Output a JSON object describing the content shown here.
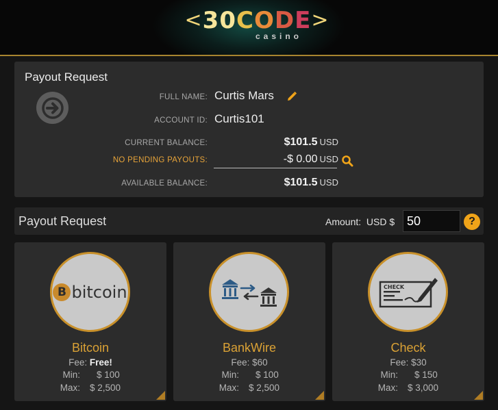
{
  "logo": {
    "bracket_left": "<",
    "digits": "30",
    "word_letters": [
      "C",
      "O",
      "D",
      "E"
    ],
    "bracket_right": ">",
    "sub": "casino"
  },
  "summary": {
    "title": "Payout Request",
    "full_name_label": "FULL NAME:",
    "full_name_value": "Curtis Mars",
    "account_id_label": "ACCOUNT ID:",
    "account_id_value": "Curtis101",
    "current_balance_label": "CURRENT BALANCE:",
    "current_balance_value": "$101.5",
    "pending_label": "NO PENDING PAYOUTS:",
    "pending_value": "-$ 0.00",
    "available_balance_label": "AVAILABLE BALANCE:",
    "available_balance_value": "$101.5",
    "currency_unit": "USD"
  },
  "request": {
    "title": "Payout Request",
    "amount_label": "Amount:",
    "currency_prefix": "USD $",
    "amount_value": "50",
    "help_label": "?"
  },
  "methods": [
    {
      "name": "Bitcoin",
      "logo_text": "bitcoin",
      "logo_symbol": "B",
      "fee_label": "Fee:",
      "fee_value": "Free!",
      "min_label": "Min:",
      "min_value": "$ 100",
      "max_label": "Max:",
      "max_value": "$ 2,500"
    },
    {
      "name": "BankWire",
      "fee_label": "Fee:",
      "fee_value": "$60",
      "min_label": "Min:",
      "min_value": "$ 100",
      "max_label": "Max:",
      "max_value": "$ 2,500"
    },
    {
      "name": "Check",
      "check_text": "CHECK",
      "fee_label": "Fee:",
      "fee_value": "$30",
      "min_label": "Min:",
      "min_value": "$ 150",
      "max_label": "Max:",
      "max_value": "$ 3,000"
    }
  ],
  "colors": {
    "accent": "#f0a419",
    "gold": "#dba235",
    "panel": "#2c2c2c",
    "background": "#151515"
  },
  "icons": {
    "arrow": "arrow-right-circle-icon",
    "edit": "pencil-icon",
    "search": "magnifier-icon",
    "help": "question-icon"
  }
}
